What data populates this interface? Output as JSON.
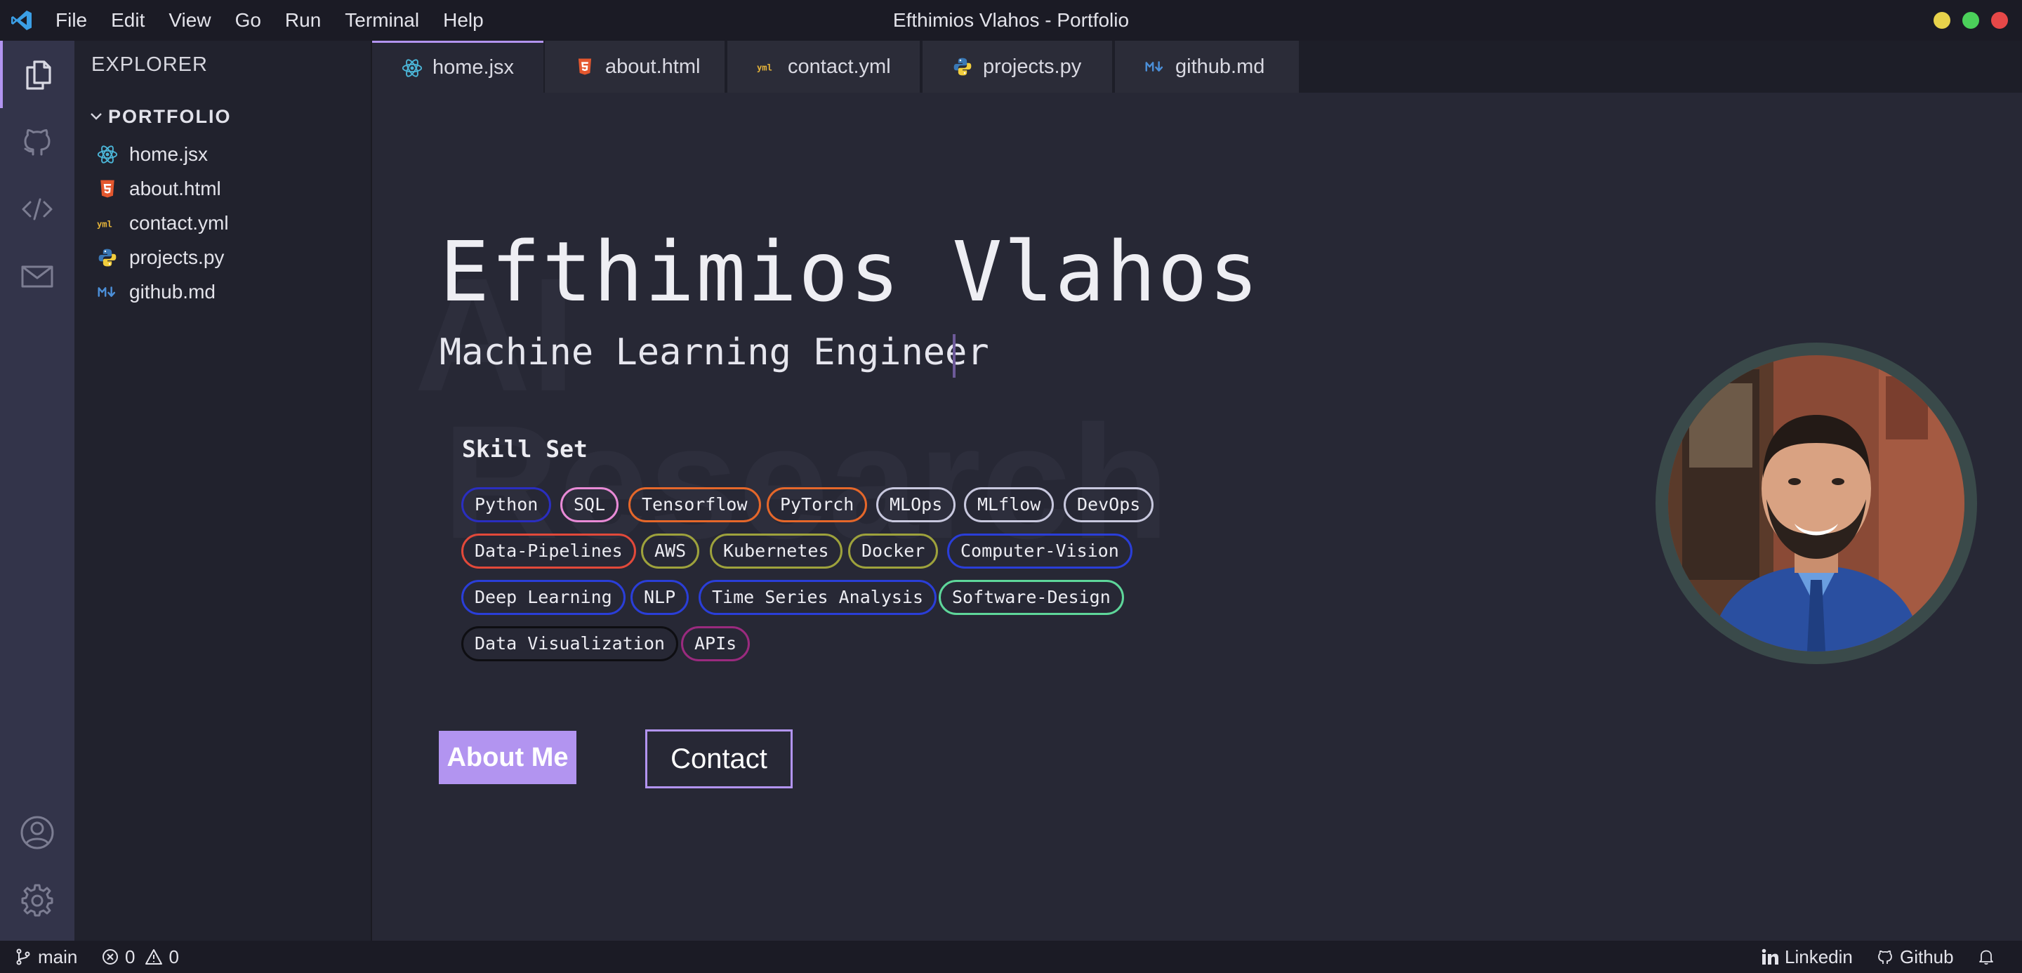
{
  "window": {
    "title": "Efthimios Vlahos - Portfolio",
    "menu": [
      "File",
      "Edit",
      "View",
      "Go",
      "Run",
      "Terminal",
      "Help"
    ],
    "controls": {
      "minimize_color": "#e7d24b",
      "maximize_color": "#4bd05a",
      "close_color": "#e64848"
    }
  },
  "activity_bar": {
    "top_icons": [
      "files-icon",
      "github-icon",
      "code-icon",
      "mail-icon"
    ],
    "bottom_icons": [
      "account-icon",
      "settings-gear-icon"
    ],
    "active": "files-icon"
  },
  "sidebar": {
    "title": "EXPLORER",
    "folder": "PORTFOLIO",
    "files": [
      {
        "name": "home.jsx",
        "icon": "react-icon"
      },
      {
        "name": "about.html",
        "icon": "html5-icon"
      },
      {
        "name": "contact.yml",
        "icon": "yaml-icon"
      },
      {
        "name": "projects.py",
        "icon": "python-icon"
      },
      {
        "name": "github.md",
        "icon": "markdown-icon"
      }
    ]
  },
  "tabs": [
    {
      "label": "home.jsx",
      "icon": "react-icon",
      "active": true
    },
    {
      "label": "about.html",
      "icon": "html5-icon",
      "active": false
    },
    {
      "label": "contact.yml",
      "icon": "yaml-icon",
      "active": false
    },
    {
      "label": "projects.py",
      "icon": "python-icon",
      "active": false
    },
    {
      "label": "github.md",
      "icon": "markdown-icon",
      "active": false
    }
  ],
  "hero": {
    "background_word_1": "AI",
    "background_word_2": "Research",
    "name": "Efthimios Vlahos",
    "role": "Machine Learning Engineer",
    "skills_title": "Skill Set",
    "skills": [
      {
        "label": "Python",
        "color": "#2a2ec0"
      },
      {
        "label": "SQL",
        "color": "#e88ad6"
      },
      {
        "label": "Tensorflow",
        "color": "#e5672a"
      },
      {
        "label": "PyTorch",
        "color": "#e5672a"
      },
      {
        "label": "MLOps",
        "color": "#c8c8de"
      },
      {
        "label": "MLflow",
        "color": "#c8c8de"
      },
      {
        "label": "DevOps",
        "color": "#c8c8de"
      },
      {
        "label": "Data-Pipelines",
        "color": "#e2493a"
      },
      {
        "label": "AWS",
        "color": "#9ea23c"
      },
      {
        "label": "Kubernetes",
        "color": "#9ea23c"
      },
      {
        "label": "Docker",
        "color": "#9ea23c"
      },
      {
        "label": "Computer-Vision",
        "color": "#2a3ed8"
      },
      {
        "label": "Deep Learning",
        "color": "#2a3ed8"
      },
      {
        "label": "NLP",
        "color": "#2a3ed8"
      },
      {
        "label": "Time Series Analysis",
        "color": "#2a3ed8"
      },
      {
        "label": "Software-Design",
        "color": "#5ed69a"
      },
      {
        "label": "Data Visualization",
        "color": "#0e0e12"
      },
      {
        "label": "APIs",
        "color": "#9a2a7e"
      }
    ],
    "about_button": "About Me",
    "contact_button": "Contact",
    "accent_color": "#b294f0"
  },
  "status_bar": {
    "branch": "main",
    "errors": "0",
    "warnings": "0",
    "linkedin": "Linkedin",
    "github": "Github"
  }
}
